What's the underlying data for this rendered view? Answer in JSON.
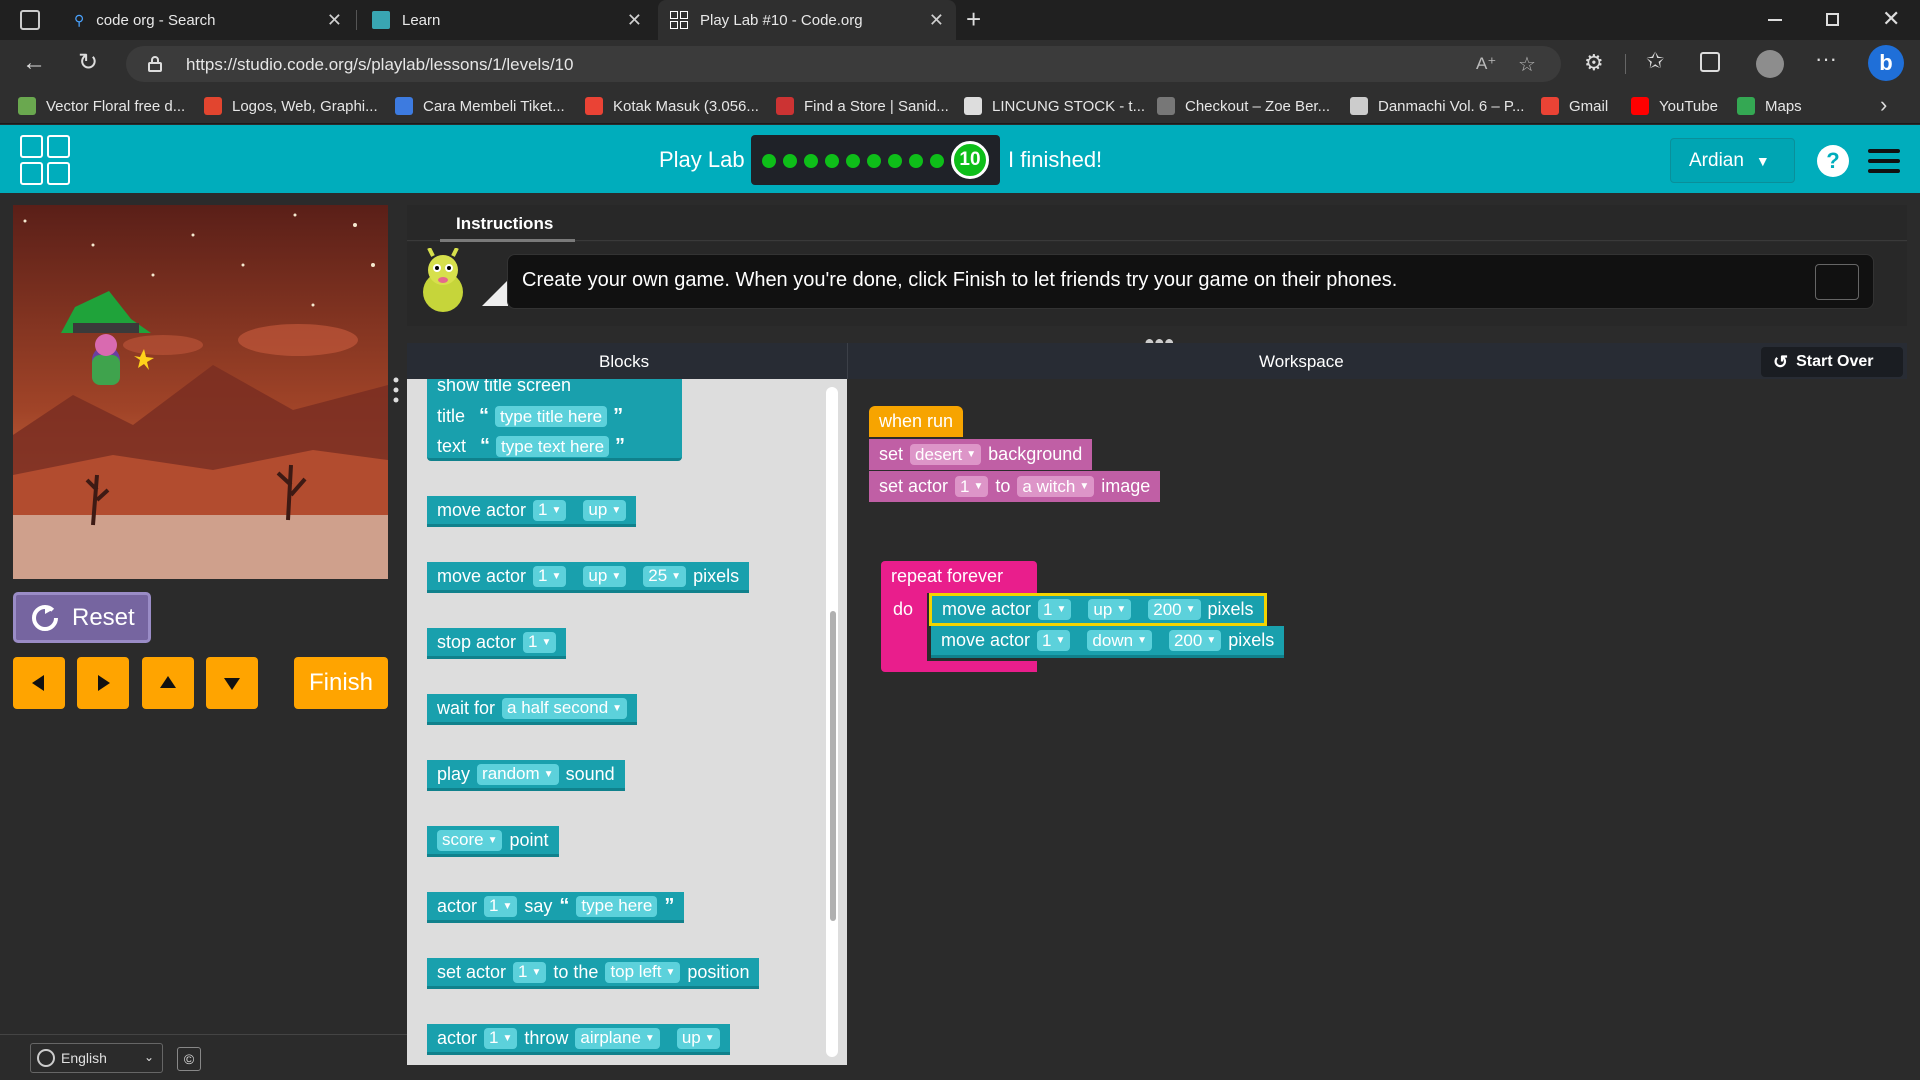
{
  "browser": {
    "tabs": [
      {
        "title": "code org - Search",
        "icon": "search-icon"
      },
      {
        "title": "Learn",
        "icon": "hour-of-code-icon"
      },
      {
        "title": "Play Lab #10 - Code.org",
        "icon": "codeorg-icon"
      }
    ],
    "url": "https://studio.code.org/s/playlab/lessons/1/levels/10",
    "bookmarks": [
      {
        "label": "Vector Floral free d...",
        "color": "#6aa84f"
      },
      {
        "label": "Logos, Web, Graphi...",
        "color": "#e2452f"
      },
      {
        "label": "Cara Membeli Tiket...",
        "color": "#3d7be0"
      },
      {
        "label": "Kotak Masuk (3.056...",
        "color": "#ea4335"
      },
      {
        "label": "Find a Store | Sanid...",
        "color": "#cc3333"
      },
      {
        "label": "LINCUNG STOCK - t...",
        "color": "#dddddd"
      },
      {
        "label": "Checkout – Zoe Ber...",
        "color": "#777777"
      },
      {
        "label": "Danmachi Vol. 6 – P...",
        "color": "#cccccc"
      },
      {
        "label": "Gmail",
        "color": "#ea4335"
      },
      {
        "label": "YouTube",
        "color": "#ff0000"
      },
      {
        "label": "Maps",
        "color": "#34a853"
      }
    ]
  },
  "header": {
    "lesson_title": "Play Lab",
    "progress": {
      "completed_levels": 9,
      "current_level": "10"
    },
    "finished_label": "I finished!",
    "user_name": "Ardian",
    "help_label": "?"
  },
  "controls": {
    "reset_label": "Reset",
    "finish_label": "Finish",
    "arrows": [
      "left-arrow-icon",
      "right-arrow-icon",
      "up-arrow-icon",
      "down-arrow-icon"
    ]
  },
  "instructions": {
    "tab_label": "Instructions",
    "text": "Create your own game. When you're done, click Finish to let friends try your game on their phones."
  },
  "panels": {
    "blocks_label": "Blocks",
    "workspace_label": "Workspace",
    "start_over_label": "Start Over"
  },
  "toolbox": {
    "show_title": "show title screen",
    "title_word": "title",
    "title_value": "type title here",
    "text_word": "text",
    "text_value": "type text here",
    "move_actor": "move actor",
    "actor_num": "1",
    "dir_up": "up",
    "amount_25": "25",
    "pixels": "pixels",
    "stop_actor": "stop actor",
    "wait_for": "wait for",
    "wait_value": "a half second",
    "play": "play",
    "sound_value": "random",
    "sound": "sound",
    "score_value": "score",
    "point": "point",
    "actor": "actor",
    "say": "say",
    "say_value": "type here",
    "set_actor": "set actor",
    "to_the": "to the",
    "position_value": "top left",
    "position": "position",
    "throw": "throw",
    "throw_value": "airplane"
  },
  "workspace": {
    "when_run": "when run",
    "set": "set",
    "bg_value": "desert",
    "background": "background",
    "set_actor": "set actor",
    "actor_num": "1",
    "to": "to",
    "image_value": "a witch",
    "image": "image",
    "repeat_forever": "repeat forever",
    "do": "do",
    "move_actor": "move actor",
    "dir_up": "up",
    "dir_down": "down",
    "amount": "200",
    "pixels": "pixels"
  },
  "footer": {
    "language": "English",
    "copyright": "©"
  },
  "colors": {
    "header": "#00adbc",
    "progress_dot": "#0ebe19",
    "control_button": "#ffa400",
    "reset_button": "#7665a0",
    "block_teal": "#19a0ad",
    "block_pink": "#e91e8c",
    "block_orange": "#f7a400",
    "block_mauve": "#c05fa5"
  }
}
